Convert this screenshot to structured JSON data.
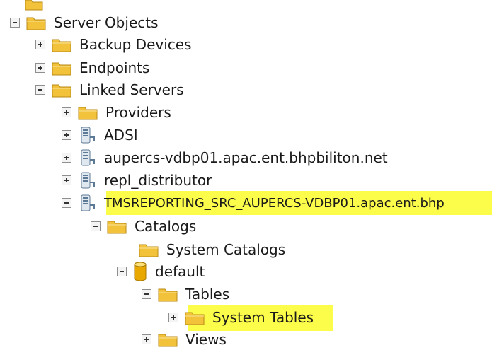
{
  "tree": {
    "server_objects": "Server Objects",
    "backup_devices": "Backup Devices",
    "endpoints": "Endpoints",
    "linked_servers": "Linked Servers",
    "providers": "Providers",
    "adsi": "ADSI",
    "aupercs": "aupercs-vdbp01.apac.ent.bhpbiliton.net",
    "repl_distributor": "repl_distributor",
    "tmsreporting": "TMSREPORTING_SRC_AUPERCS-VDBP01.apac.ent.bhp",
    "catalogs": "Catalogs",
    "system_catalogs": "System Catalogs",
    "default": "default",
    "tables": "Tables",
    "system_tables": "System Tables",
    "views": "Views"
  },
  "colors": {
    "highlight": "#fcfc4a",
    "folder": "#f2c23a",
    "database": "#e8a800"
  }
}
